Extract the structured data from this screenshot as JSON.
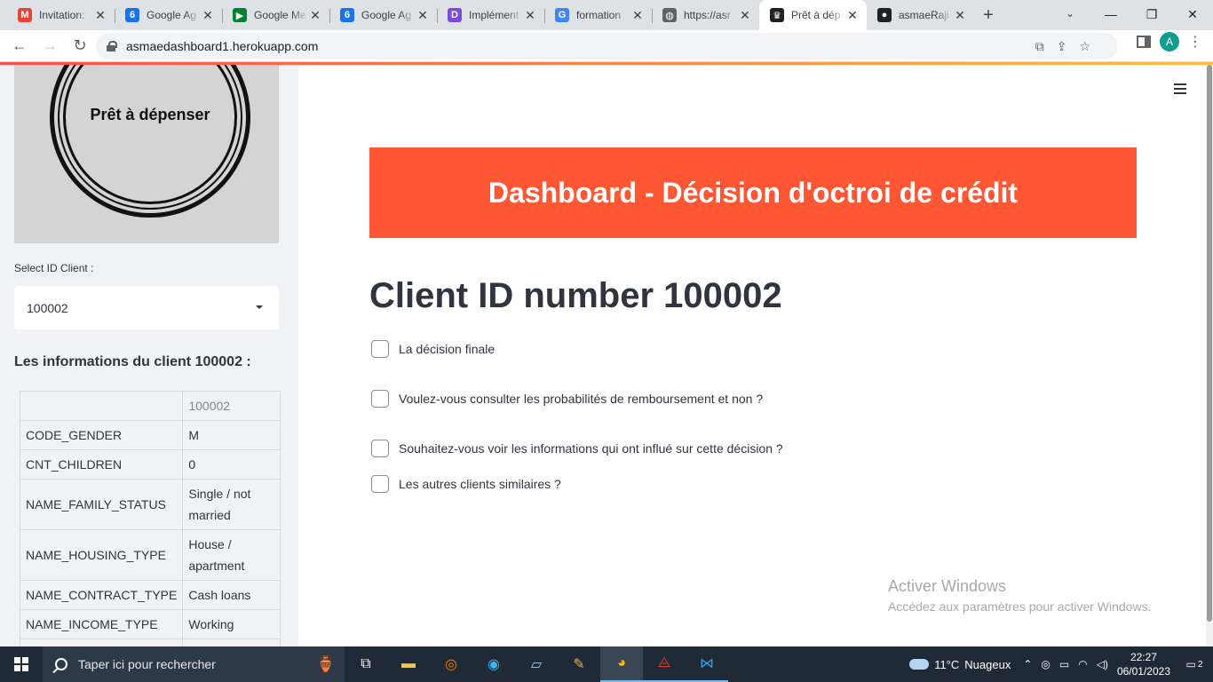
{
  "browser": {
    "tabs": [
      {
        "title": "Invitation:",
        "favicon": "gmail-icon",
        "favicon_color": "#ea4335",
        "glyph": "M",
        "active": false
      },
      {
        "title": "Google Ag",
        "favicon": "calendar-icon",
        "favicon_color": "#1a73e8",
        "glyph": "6",
        "active": false
      },
      {
        "title": "Google Me",
        "favicon": "meet-icon",
        "favicon_color": "#00832d",
        "glyph": "▶",
        "active": false
      },
      {
        "title": "Google Ag",
        "favicon": "calendar-icon",
        "favicon_color": "#1a73e8",
        "glyph": "6",
        "active": false
      },
      {
        "title": "Implément",
        "favicon": "app-icon",
        "favicon_color": "#7b4bd8",
        "glyph": "D",
        "active": false
      },
      {
        "title": "formation",
        "favicon": "google-icon",
        "favicon_color": "#4285f4",
        "glyph": "G",
        "active": false
      },
      {
        "title": "https://asr",
        "favicon": "globe-icon",
        "favicon_color": "#5f6368",
        "glyph": "◍",
        "active": false
      },
      {
        "title": "Prêt à dép",
        "favicon": "streamlit-icon",
        "favicon_color": "#202124",
        "glyph": "♛",
        "active": true
      },
      {
        "title": "asmaeRaji",
        "favicon": "github-icon",
        "favicon_color": "#202124",
        "glyph": "●",
        "active": false
      }
    ],
    "new_tab_glyph": "+",
    "url": "asmaedashboard1.herokuapp.com",
    "avatar_letter": "A"
  },
  "sidebar": {
    "logo_text": "Prêt à dépenser",
    "select_label": "Select ID Client :",
    "selected_id": "100002",
    "info_title": "Les informations du client 100002 :",
    "table": {
      "header_value": "100002",
      "rows": [
        {
          "key": "CODE_GENDER",
          "value": "M"
        },
        {
          "key": "CNT_CHILDREN",
          "value": "0"
        },
        {
          "key": "NAME_FAMILY_STATUS",
          "value": "Single / not married"
        },
        {
          "key": "NAME_HOUSING_TYPE",
          "value": "House / apartment"
        },
        {
          "key": "NAME_CONTRACT_TYPE",
          "value": "Cash loans"
        },
        {
          "key": "NAME_INCOME_TYPE",
          "value": "Working"
        }
      ]
    }
  },
  "main": {
    "banner_title": "Dashboard - Décision d'octroi de crédit",
    "client_heading": "Client ID number 100002",
    "checkboxes": [
      "La décision finale",
      "Voulez-vous consulter les probabilités de remboursement et non ?",
      "Souhaitez-vous voir les informations qui ont influé sur cette décision ?",
      "Les autres clients similaires ?"
    ],
    "banner_color": "#ff5733"
  },
  "watermark": {
    "line1": "Activer Windows",
    "line2": "Accédez aux paramètres pour activer Windows."
  },
  "taskbar": {
    "search_placeholder": "Taper ici pour rechercher",
    "weather_temp": "11°C",
    "weather_desc": "Nuageux",
    "time": "22:27",
    "date": "06/01/2023",
    "notifications": "2"
  }
}
